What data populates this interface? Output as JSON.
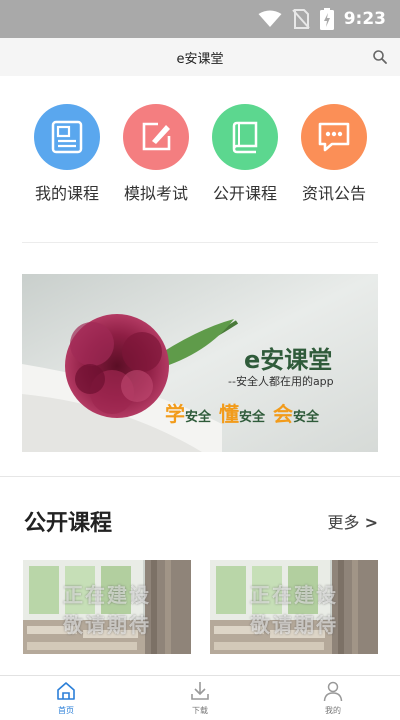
{
  "status_bar": {
    "time": "9:23"
  },
  "header": {
    "title": "e安课堂"
  },
  "quick_links": [
    {
      "label": "我的课程",
      "color": "#5aa7ee",
      "icon": "news-icon"
    },
    {
      "label": "模拟考试",
      "color": "#f47e80",
      "icon": "edit-icon"
    },
    {
      "label": "公开课程",
      "color": "#5cd78f",
      "icon": "book-icon"
    },
    {
      "label": "资讯公告",
      "color": "#fb8f57",
      "icon": "chat-icon"
    }
  ],
  "banner": {
    "title": "e安课堂",
    "subtitle": "--安全人都在用的app",
    "slogan": [
      {
        "big": "学",
        "small": "安全"
      },
      {
        "big": "懂",
        "small": "安全"
      },
      {
        "big": "会",
        "small": "安全"
      }
    ]
  },
  "public_courses": {
    "title": "公开课程",
    "more_label": "更多",
    "more_arrow": ">",
    "cards": [
      {
        "line1": "正在建设",
        "line2": "敬请期待"
      },
      {
        "line1": "正在建设",
        "line2": "敬请期待"
      }
    ]
  },
  "bottom_nav": [
    {
      "label": "首页",
      "icon": "home-icon",
      "active": true
    },
    {
      "label": "下载",
      "icon": "download-icon",
      "active": false
    },
    {
      "label": "我的",
      "icon": "user-icon",
      "active": false
    }
  ],
  "colors": {
    "status_bar": "#a9a9a9",
    "accent": "#2b7fd8",
    "slogan_orange": "#f29b1a"
  }
}
